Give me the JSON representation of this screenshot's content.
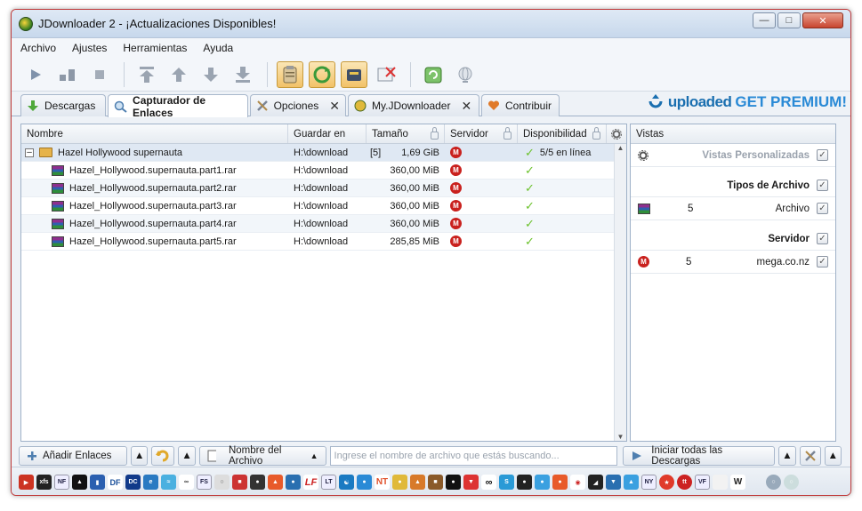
{
  "window": {
    "title": "JDownloader 2 - ¡Actualizaciones Disponibles!"
  },
  "menu": [
    "Archivo",
    "Ajustes",
    "Herramientas",
    "Ayuda"
  ],
  "tabs": [
    {
      "label": "Descargas"
    },
    {
      "label": "Capturador de Enlaces"
    },
    {
      "label": "Opciones"
    },
    {
      "label": "My.JDownloader"
    },
    {
      "label": "Contribuir"
    }
  ],
  "promo": {
    "brand": "uploaded",
    "cta": "GET PREMIUM!"
  },
  "table": {
    "headers": [
      "Nombre",
      "Guardar en",
      "Tamaño",
      "Servidor",
      "Disponibilidad"
    ],
    "package": {
      "expander": "[-]",
      "name": "Hazel Hollywood supernauta",
      "save": "H:\\download",
      "count": "[5]",
      "size": "1,69 GiB",
      "availability": "5/5 en línea"
    },
    "rows": [
      {
        "name": "Hazel_Hollywood.supernauta.part1.rar",
        "save": "H:\\download",
        "size": "360,00 MiB"
      },
      {
        "name": "Hazel_Hollywood.supernauta.part2.rar",
        "save": "H:\\download",
        "size": "360,00 MiB"
      },
      {
        "name": "Hazel_Hollywood.supernauta.part3.rar",
        "save": "H:\\download",
        "size": "360,00 MiB"
      },
      {
        "name": "Hazel_Hollywood.supernauta.part4.rar",
        "save": "H:\\download",
        "size": "360,00 MiB"
      },
      {
        "name": "Hazel_Hollywood.supernauta.part5.rar",
        "save": "H:\\download",
        "size": "285,85 MiB"
      }
    ]
  },
  "side": {
    "title": "Vistas",
    "custom": "Vistas Personalizadas",
    "filetypes_title": "Tipos de Archivo",
    "filetype": {
      "count": "5",
      "label": "Archivo"
    },
    "server_title": "Servidor",
    "server": {
      "count": "5",
      "label": "mega.co.nz"
    }
  },
  "bottom": {
    "add_links": "Añadir Enlaces",
    "filename_mode": "Nombre del Archivo",
    "search_placeholder": "Ingrese el nombre de archivo que estás buscando...",
    "start_all": "Iniciar todas las Descargas"
  }
}
